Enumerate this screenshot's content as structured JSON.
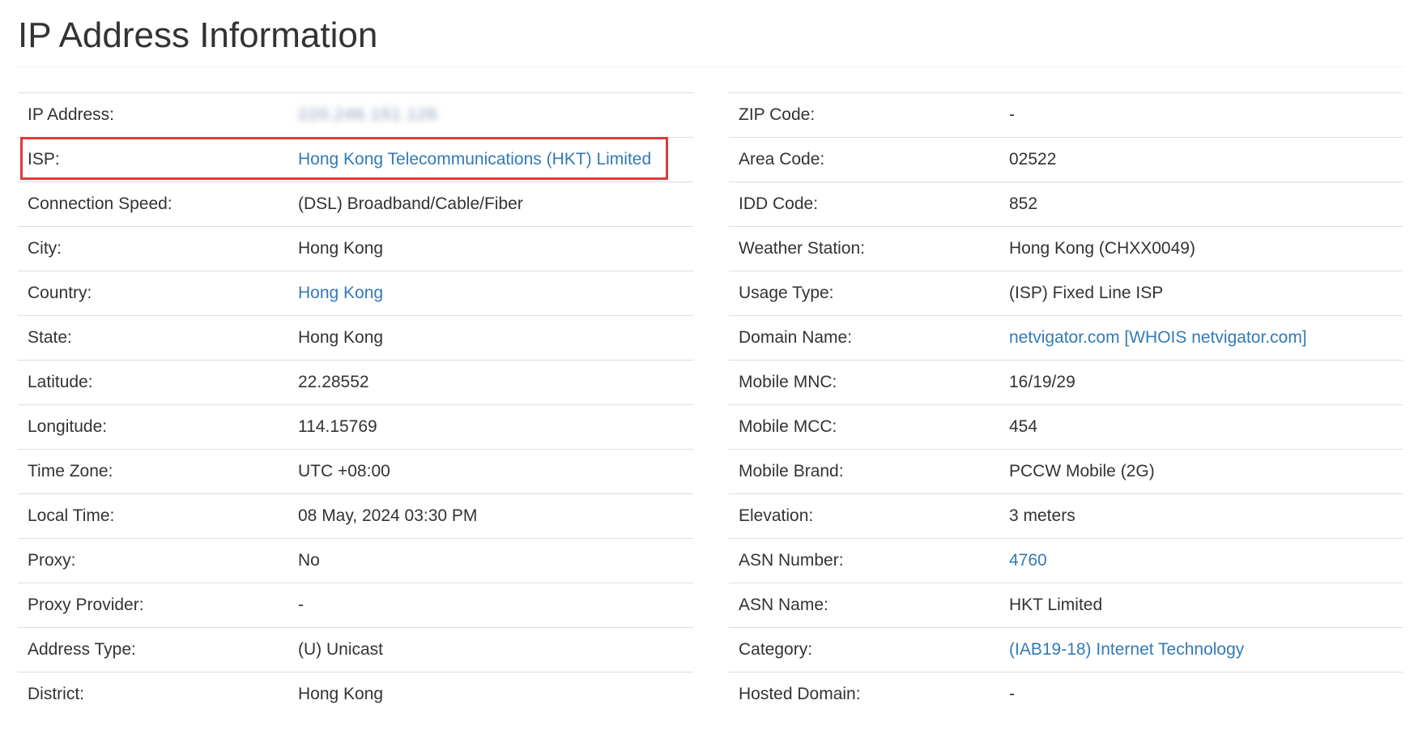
{
  "page": {
    "title": "IP Address Information"
  },
  "left_rows": [
    {
      "label": "IP Address:",
      "value": "220.246.151.126",
      "link": false,
      "blurred": true
    },
    {
      "label": "ISP:",
      "value": "Hong Kong Telecommunications (HKT) Limited",
      "link": true
    },
    {
      "label": "Connection Speed:",
      "value": "(DSL) Broadband/Cable/Fiber",
      "link": false
    },
    {
      "label": "City:",
      "value": "Hong Kong",
      "link": false
    },
    {
      "label": "Country:",
      "value": "Hong Kong",
      "link": true
    },
    {
      "label": "State:",
      "value": "Hong Kong",
      "link": false
    },
    {
      "label": "Latitude:",
      "value": "22.28552",
      "link": false
    },
    {
      "label": "Longitude:",
      "value": "114.15769",
      "link": false
    },
    {
      "label": "Time Zone:",
      "value": "UTC +08:00",
      "link": false
    },
    {
      "label": "Local Time:",
      "value": "08 May, 2024 03:30 PM",
      "link": false
    },
    {
      "label": "Proxy:",
      "value": "No",
      "link": false
    },
    {
      "label": "Proxy Provider:",
      "value": "-",
      "link": false
    },
    {
      "label": "Address Type:",
      "value": "(U) Unicast",
      "link": false
    },
    {
      "label": "District:",
      "value": "Hong Kong",
      "link": false
    }
  ],
  "right_rows": [
    {
      "label": "ZIP Code:",
      "value": "-",
      "link": false
    },
    {
      "label": "Area Code:",
      "value": "02522",
      "link": false
    },
    {
      "label": "IDD Code:",
      "value": "852",
      "link": false
    },
    {
      "label": "Weather Station:",
      "value": "Hong Kong (CHXX0049)",
      "link": false
    },
    {
      "label": "Usage Type:",
      "value": "(ISP) Fixed Line ISP",
      "link": false
    },
    {
      "label": "Domain Name:",
      "value": "netvigator.com [WHOIS netvigator.com]",
      "link": true
    },
    {
      "label": "Mobile MNC:",
      "value": "16/19/29",
      "link": false
    },
    {
      "label": "Mobile MCC:",
      "value": "454",
      "link": false
    },
    {
      "label": "Mobile Brand:",
      "value": "PCCW Mobile (2G)",
      "link": false
    },
    {
      "label": "Elevation:",
      "value": "3 meters",
      "link": false
    },
    {
      "label": "ASN Number:",
      "value": "4760",
      "link": true
    },
    {
      "label": "ASN Name:",
      "value": "HKT Limited",
      "link": false
    },
    {
      "label": "Category:",
      "value": "(IAB19-18) Internet Technology",
      "link": true
    },
    {
      "label": "Hosted Domain:",
      "value": "-",
      "link": false
    }
  ],
  "colors": {
    "text": "#333333",
    "link": "#337ab7",
    "border": "#dddddd",
    "highlight": "#e03a3a"
  }
}
